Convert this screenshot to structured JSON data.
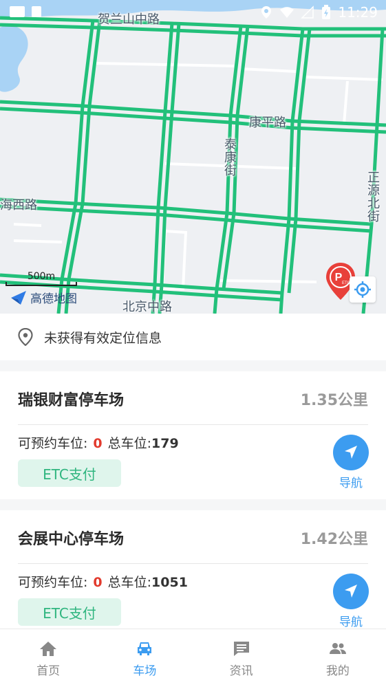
{
  "status_bar": {
    "time": "11:29"
  },
  "map": {
    "labels": {
      "helanshan": "贺兰山中路",
      "kangping": "康平路",
      "taikang": "泰康街",
      "zhengyuan": "正源北街",
      "haixi": "海西路",
      "beijing": "北京中路"
    },
    "scale_text": "500m",
    "logo_text": "高德地图",
    "marker_badge": "ETC"
  },
  "location": {
    "text": "未获得有效定位信息"
  },
  "lots": [
    {
      "name": "瑞银财富停车场",
      "distance": "1.35公里",
      "available_label": "可预约车位:",
      "available": "0",
      "total_label": "总车位:",
      "total": "179",
      "tag": "ETC支付",
      "nav_label": "导航"
    },
    {
      "name": "会展中心停车场",
      "distance": "1.42公里",
      "available_label": "可预约车位:",
      "available": "0",
      "total_label": "总车位:",
      "total": "1051",
      "tag": "ETC支付",
      "nav_label": "导航"
    }
  ],
  "tabs": [
    {
      "label": "首页",
      "icon": "home-icon"
    },
    {
      "label": "车场",
      "icon": "car-icon",
      "active": true
    },
    {
      "label": "资讯",
      "icon": "message-icon"
    },
    {
      "label": "我的",
      "icon": "people-icon"
    }
  ],
  "colors": {
    "accent": "#3c9cf0",
    "road": "#22c07a",
    "water": "#a9d3f5",
    "available": "#e23b2e",
    "etc_tag_bg": "#dff5ec",
    "etc_tag_text": "#2fb57f",
    "marker": "#e8403a"
  }
}
